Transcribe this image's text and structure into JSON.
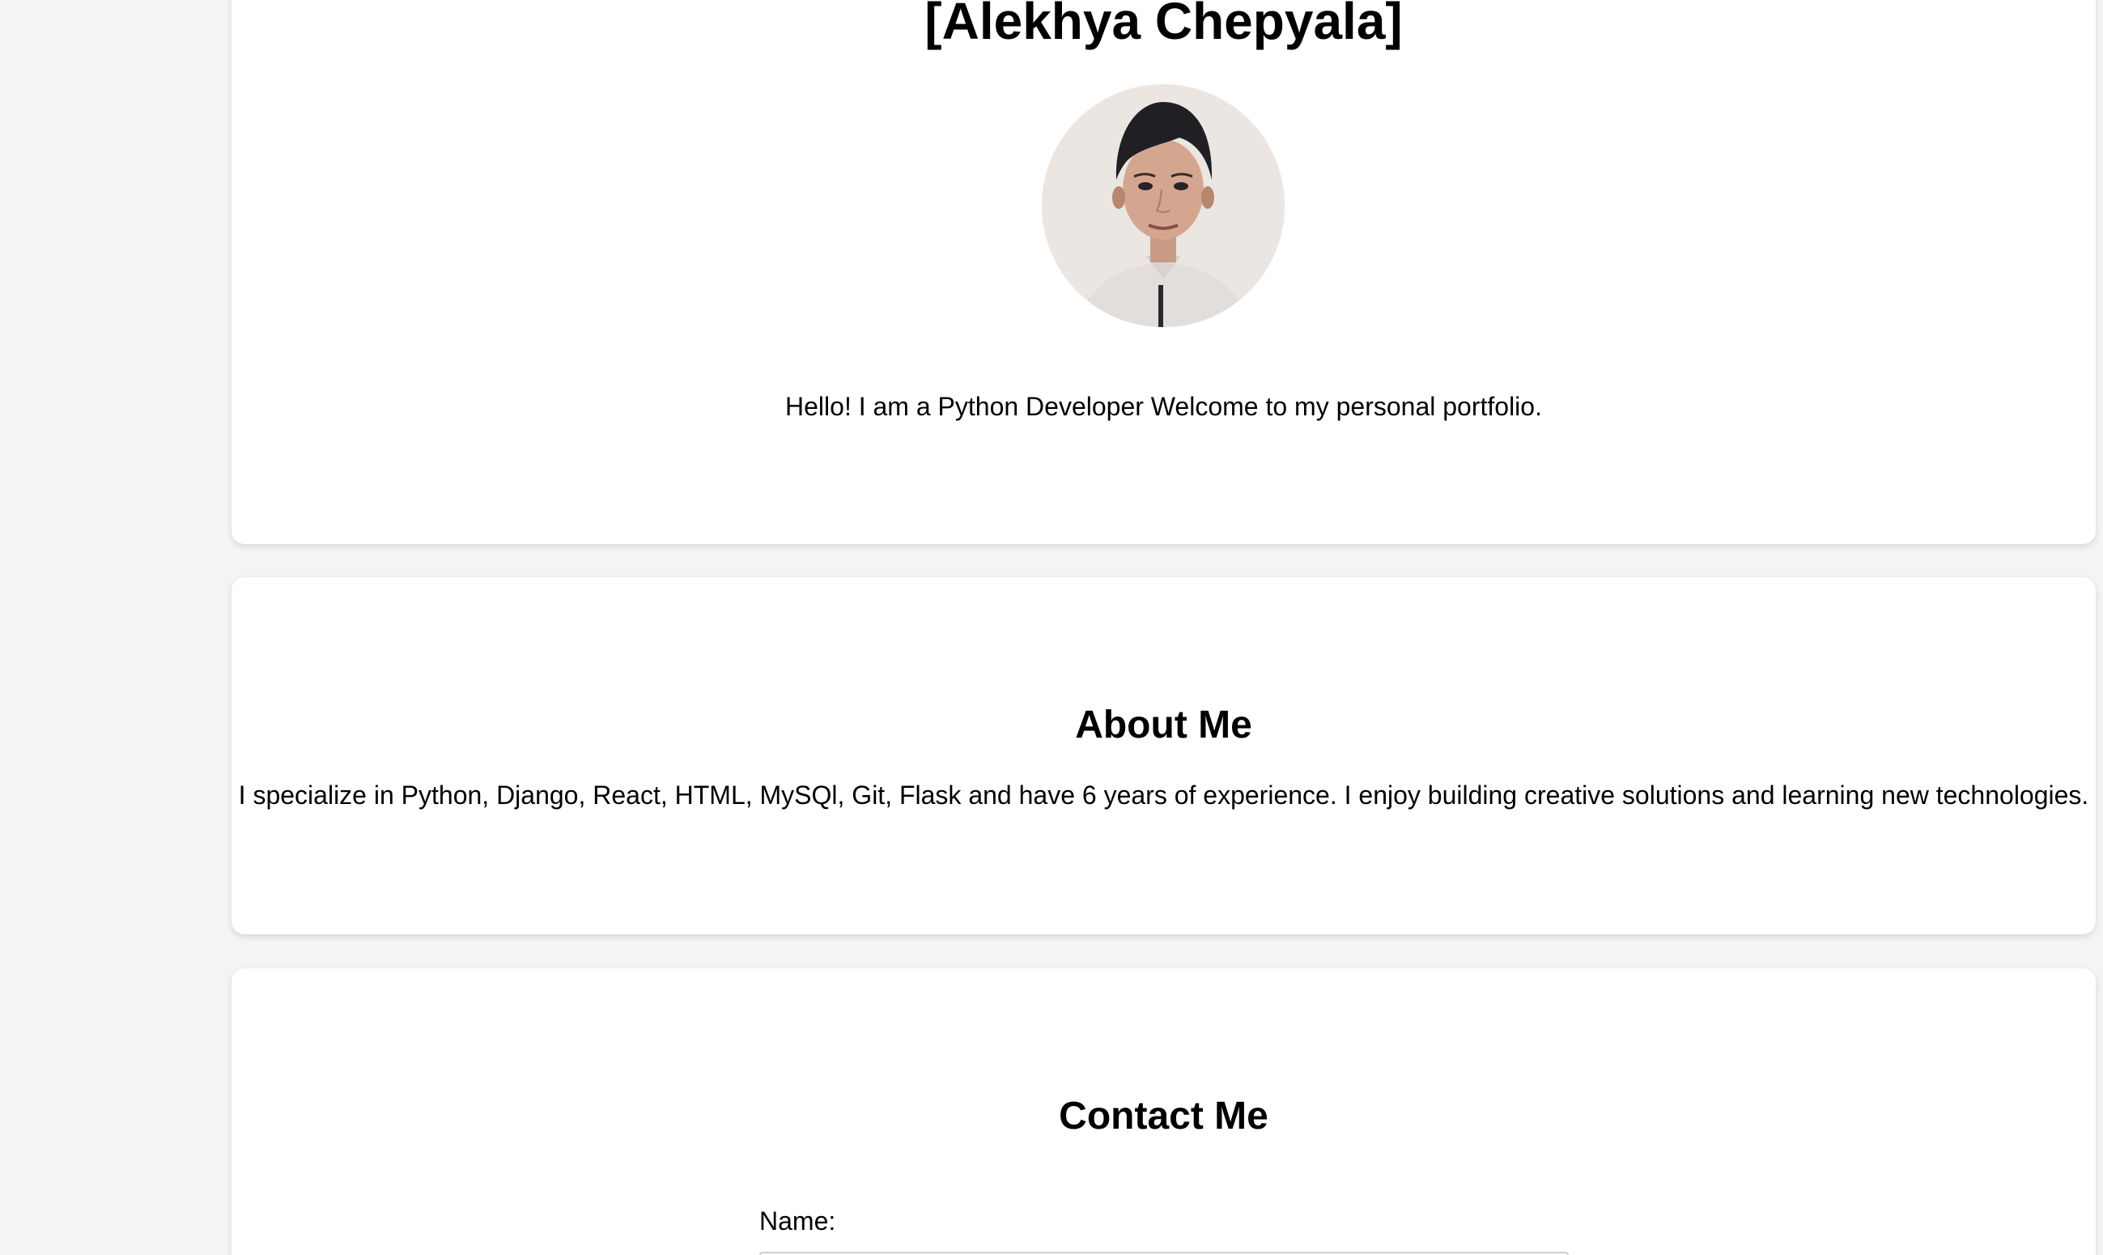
{
  "hero": {
    "name": "[Alekhya Chepyala]",
    "intro": "Hello! I am a Python Developer Welcome to my personal portfolio."
  },
  "about": {
    "title": "About Me",
    "text": "I specialize in Python, Django, React, HTML, MySQl, Git, Flask and have 6 years of experience. I enjoy building creative solutions and learning new technologies."
  },
  "contact": {
    "title": "Contact Me",
    "name_label": "Name:",
    "name_value": ""
  },
  "colors": {
    "page_background": "#f4f4f4",
    "card_background": "#ffffff",
    "text": "#000000"
  }
}
